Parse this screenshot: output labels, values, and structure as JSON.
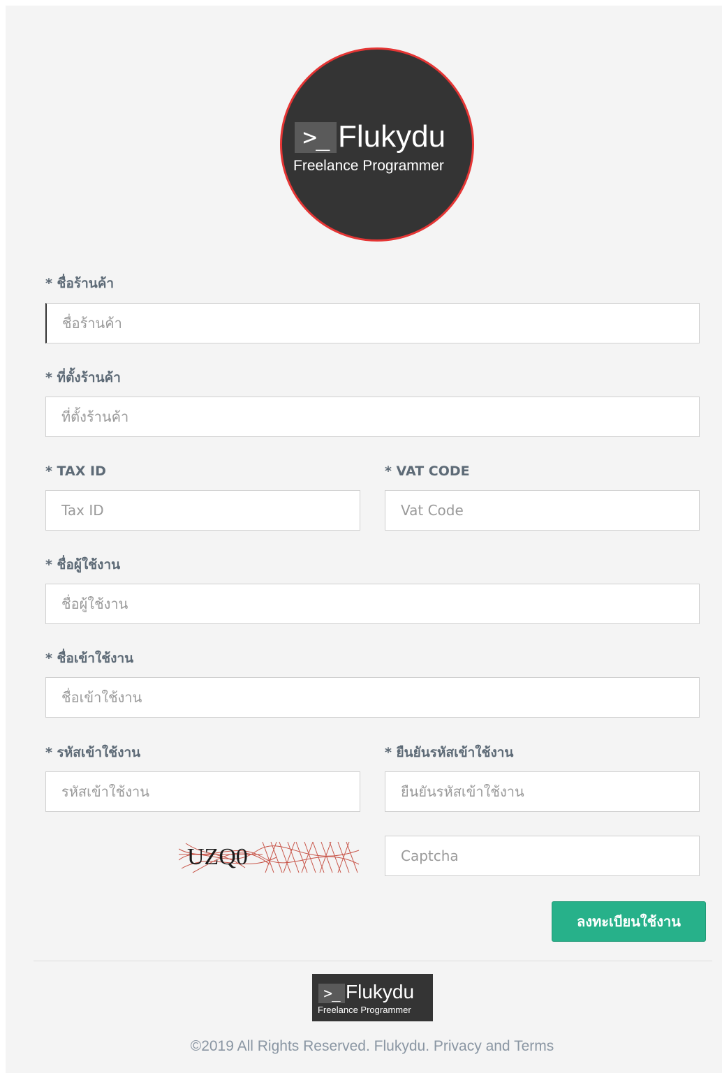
{
  "logo": {
    "prompt": ">_",
    "name": "Flukydu",
    "tagline": "Freelance Programmer"
  },
  "form": {
    "shop_name": {
      "label": "* ชื่อร้านค้า",
      "placeholder": "ชื่อร้านค้า"
    },
    "shop_location": {
      "label": "* ที่ตั้งร้านค้า",
      "placeholder": "ที่ตั้งร้านค้า"
    },
    "tax_id": {
      "label": "* TAX ID",
      "placeholder": "Tax ID"
    },
    "vat_code": {
      "label": "* VAT CODE",
      "placeholder": "Vat Code"
    },
    "display_name": {
      "label": "* ชื่อผู้ใช้งาน",
      "placeholder": "ชื่อผู้ใช้งาน"
    },
    "login_name": {
      "label": "* ชื่อเข้าใช้งาน",
      "placeholder": "ชื่อเข้าใช้งาน"
    },
    "password": {
      "label": "* รหัสเข้าใช้งาน",
      "placeholder": "รหัสเข้าใช้งาน"
    },
    "confirm_password": {
      "label": "* ยืนยันรหัสเข้าใช้งาน",
      "placeholder": "ยืนยันรหัสเข้าใช้งาน"
    },
    "captcha": {
      "image_text": "UZQ0",
      "placeholder": "Captcha"
    },
    "submit_label": "ลงทะเบียนใช้งาน"
  },
  "footer": {
    "logo": {
      "prompt": ">_",
      "name": "Flukydu",
      "tagline": "Freelance Programmer"
    },
    "copyright": "©2019 All Rights Reserved. Flukydu.",
    "privacy_link": "Privacy",
    "and_text": "and",
    "terms_link": "Terms"
  },
  "colors": {
    "panel_background": "#f4f4f4",
    "label": "#5d6a76",
    "button": "#27b18a",
    "logo_background": "#343434",
    "logo_border": "#e53534",
    "footer_text": "#8a96a3"
  }
}
